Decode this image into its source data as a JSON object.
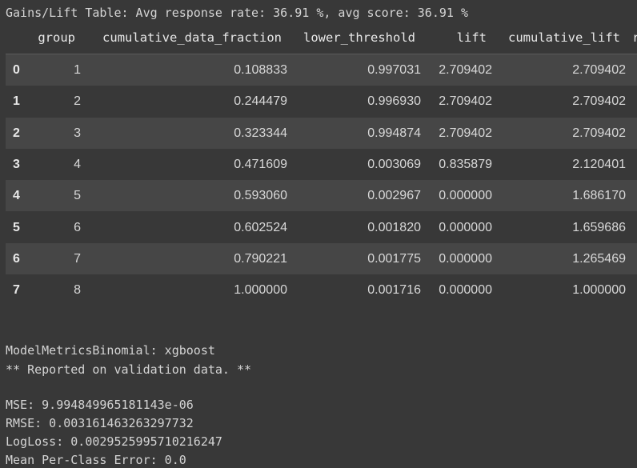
{
  "output": {
    "title_line": "Gains/Lift Table: Avg response rate: 36.91 %, avg score: 36.91 %"
  },
  "table": {
    "columns": [
      "group",
      "cumulative_data_fraction",
      "lower_threshold",
      "lift",
      "cumulative_lift",
      "r"
    ],
    "rows": [
      {
        "index": "0",
        "group": "1",
        "cdf": "0.108833",
        "lt": "0.997031",
        "lift": "2.709402",
        "clift": "2.709402"
      },
      {
        "index": "1",
        "group": "2",
        "cdf": "0.244479",
        "lt": "0.996930",
        "lift": "2.709402",
        "clift": "2.709402"
      },
      {
        "index": "2",
        "group": "3",
        "cdf": "0.323344",
        "lt": "0.994874",
        "lift": "2.709402",
        "clift": "2.709402"
      },
      {
        "index": "3",
        "group": "4",
        "cdf": "0.471609",
        "lt": "0.003069",
        "lift": "0.835879",
        "clift": "2.120401"
      },
      {
        "index": "4",
        "group": "5",
        "cdf": "0.593060",
        "lt": "0.002967",
        "lift": "0.000000",
        "clift": "1.686170"
      },
      {
        "index": "5",
        "group": "6",
        "cdf": "0.602524",
        "lt": "0.001820",
        "lift": "0.000000",
        "clift": "1.659686"
      },
      {
        "index": "6",
        "group": "7",
        "cdf": "0.790221",
        "lt": "0.001775",
        "lift": "0.000000",
        "clift": "1.265469"
      },
      {
        "index": "7",
        "group": "8",
        "cdf": "1.000000",
        "lt": "0.001716",
        "lift": "0.000000",
        "clift": "1.000000"
      }
    ]
  },
  "metrics": {
    "header": "ModelMetricsBinomial: xgboost",
    "note": "** Reported on validation data. **",
    "mse": "MSE: 9.994849965181143e-06",
    "rmse": "RMSE: 0.003161463263297732",
    "logloss": "LogLoss: 0.0029525995710216247",
    "mpce": "Mean Per-Class Error: 0.0"
  }
}
